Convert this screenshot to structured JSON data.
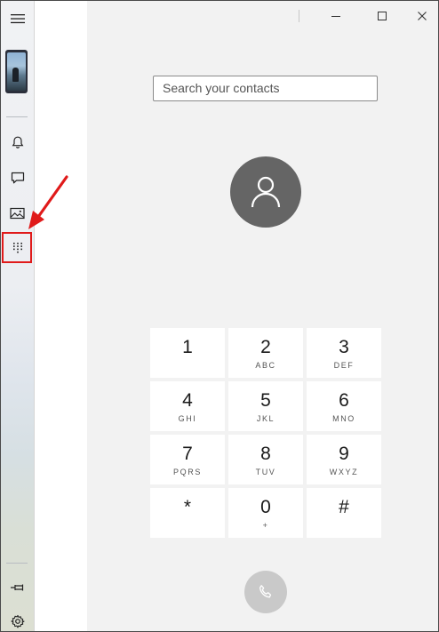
{
  "window": {
    "minimize_icon": "minimize-icon",
    "maximize_icon": "maximize-icon",
    "close_icon": "close-icon"
  },
  "sidebar": {
    "items": [
      {
        "id": "menu",
        "icon": "hamburger-menu-icon"
      },
      {
        "id": "phone-screen",
        "icon": "phone-thumbnail"
      },
      {
        "id": "notifications",
        "icon": "bell-icon"
      },
      {
        "id": "messages",
        "icon": "message-icon"
      },
      {
        "id": "photos",
        "icon": "photo-icon"
      },
      {
        "id": "calls",
        "icon": "dialpad-icon",
        "highlighted": true
      },
      {
        "id": "pin",
        "icon": "pin-icon"
      },
      {
        "id": "settings",
        "icon": "gear-icon"
      }
    ],
    "annotation_color": "#e01a1a"
  },
  "search": {
    "placeholder": "Search your contacts"
  },
  "dialpad": {
    "keys": [
      {
        "digit": "1",
        "letters": ""
      },
      {
        "digit": "2",
        "letters": "ABC"
      },
      {
        "digit": "3",
        "letters": "DEF"
      },
      {
        "digit": "4",
        "letters": "GHI"
      },
      {
        "digit": "5",
        "letters": "JKL"
      },
      {
        "digit": "6",
        "letters": "MNO"
      },
      {
        "digit": "7",
        "letters": "PQRS"
      },
      {
        "digit": "8",
        "letters": "TUV"
      },
      {
        "digit": "9",
        "letters": "WXYZ"
      },
      {
        "digit": "*",
        "letters": ""
      },
      {
        "digit": "0",
        "letters": "+"
      },
      {
        "digit": "#",
        "letters": ""
      }
    ]
  },
  "call_button": {
    "icon": "phone-handset-icon",
    "enabled": false
  },
  "colors": {
    "avatar_bg": "#656565",
    "call_button_bg": "#c9c9c9",
    "main_bg": "#f2f2f2"
  }
}
